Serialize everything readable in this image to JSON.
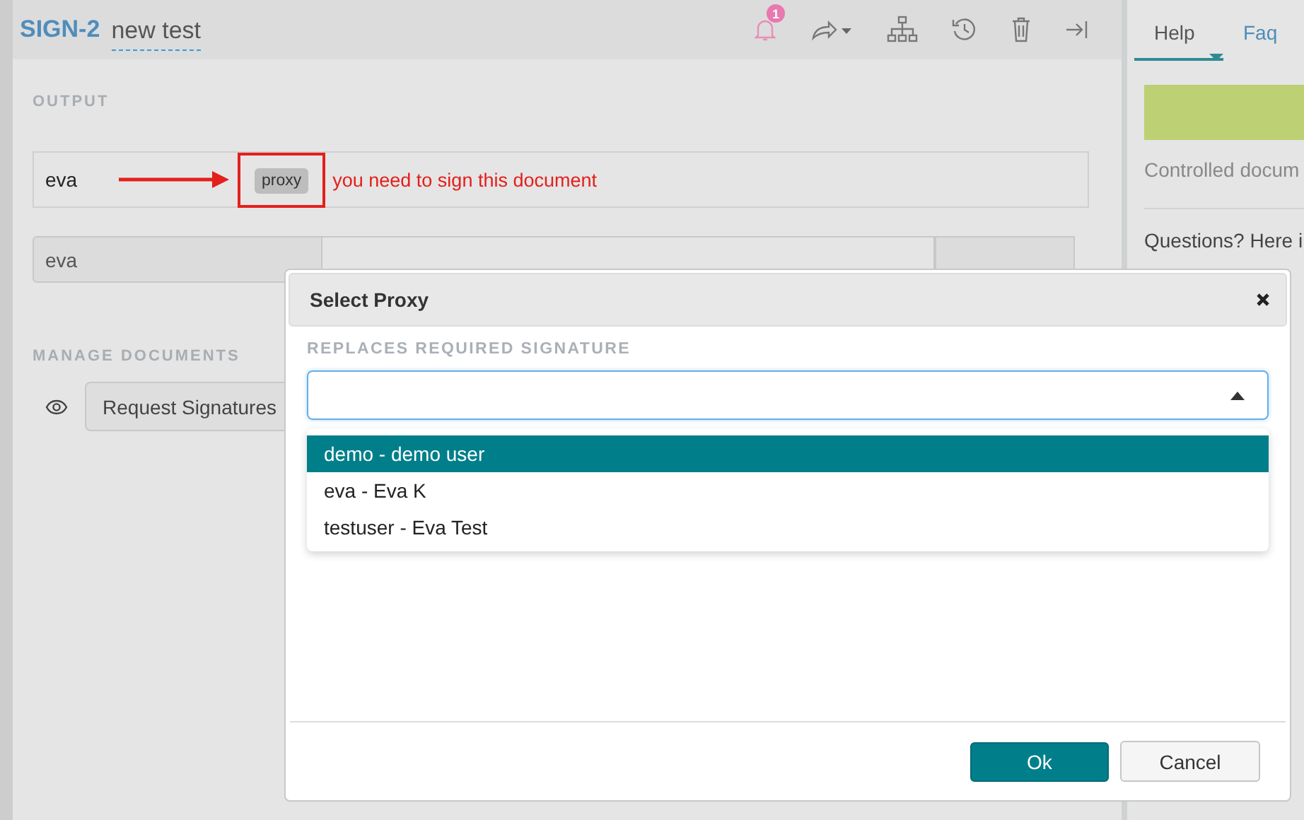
{
  "header": {
    "key": "SIGN-2",
    "title": "new test",
    "notification_count": "1"
  },
  "output": {
    "heading": "OUTPUT",
    "signer": "eva",
    "proxy_button": "proxy",
    "message": "you need to sign this document",
    "username": "eva"
  },
  "manage": {
    "heading": "MANAGE DOCUMENTS",
    "button": "Request Signatures"
  },
  "side_panel": {
    "tabs": [
      {
        "label": "Help",
        "selected": true
      },
      {
        "label": "Faq",
        "selected": false
      }
    ],
    "text": "Controlled docum",
    "question": "Questions? Here i"
  },
  "dialog": {
    "title": "Select Proxy",
    "field_label": "REPLACES REQUIRED SIGNATURE",
    "options": [
      {
        "label": "demo - demo user",
        "selected": true
      },
      {
        "label": "eva - Eva K",
        "selected": false
      },
      {
        "label": "testuser - Eva Test",
        "selected": false
      }
    ],
    "ok_button": "Ok",
    "cancel_button": "Cancel"
  }
}
